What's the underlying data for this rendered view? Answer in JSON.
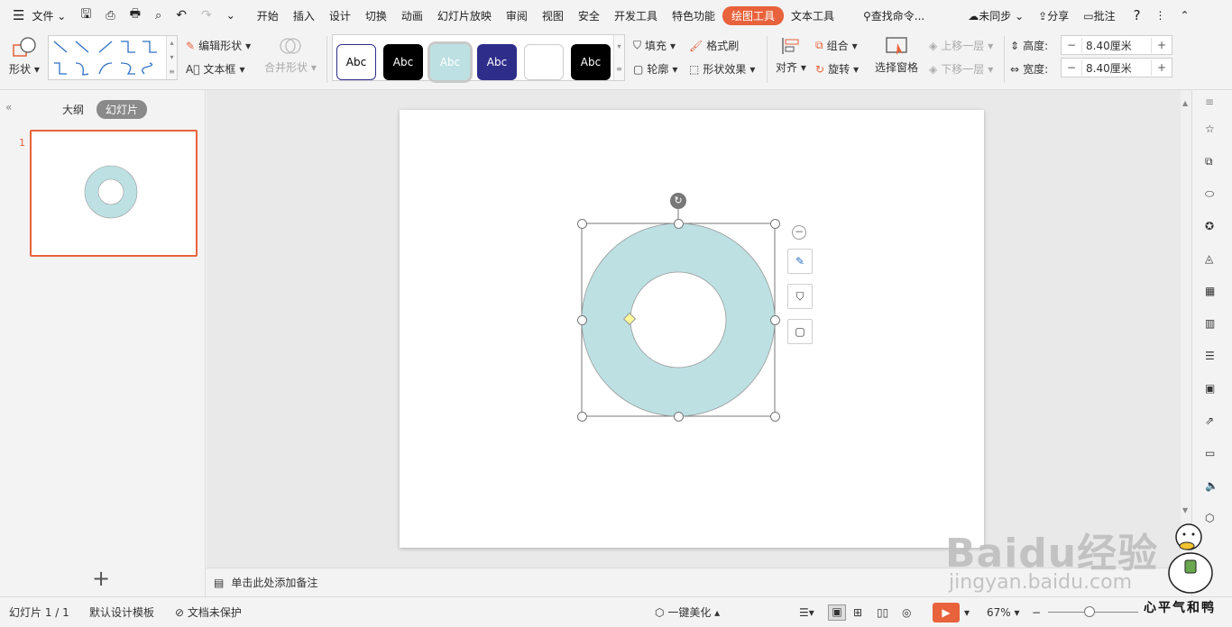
{
  "menu": {
    "file": "文件",
    "tabs": [
      "开始",
      "插入",
      "设计",
      "切换",
      "动画",
      "幻灯片放映",
      "审阅",
      "视图",
      "安全",
      "开发工具",
      "特色功能",
      "绘图工具",
      "文本工具"
    ],
    "active_tab": "绘图工具",
    "search": "查找命令...",
    "sync": "未同步",
    "share": "分享",
    "comment": "批注"
  },
  "ribbon": {
    "shape": "形状",
    "edit_shape": "编辑形状",
    "textbox": "文本框",
    "merge_shape": "合并形状",
    "styles": [
      "Abc",
      "Abc",
      "Abc",
      "Abc",
      "",
      "Abc"
    ],
    "fill": "填充",
    "format_brush": "格式刷",
    "outline": "轮廓",
    "shape_effect": "形状效果",
    "align": "对齐",
    "group": "组合",
    "rotate": "旋转",
    "selection_pane": "选择窗格",
    "bring_forward": "上移一层",
    "send_backward": "下移一层",
    "height_label": "高度:",
    "height_value": "8.40厘米",
    "width_label": "宽度:",
    "width_value": "8.40厘米"
  },
  "left_pane": {
    "outline_tab": "大纲",
    "slides_tab": "幻灯片",
    "slide_number": "1",
    "add": "+"
  },
  "notes": {
    "placeholder": "单击此处添加备注"
  },
  "status": {
    "slide_info": "幻灯片 1 / 1",
    "template": "默认设计模板",
    "protect": "文档未保护",
    "beautify": "一键美化",
    "zoom": "67%"
  },
  "colors": {
    "accent": "#e8623b",
    "donut_fill": "#bde0e3",
    "selected_thumb_border": "#e8623b"
  },
  "watermark": {
    "logo": "Baidu经验",
    "url": "jingyan.baidu.com",
    "slogan": "心平气和鸭"
  }
}
